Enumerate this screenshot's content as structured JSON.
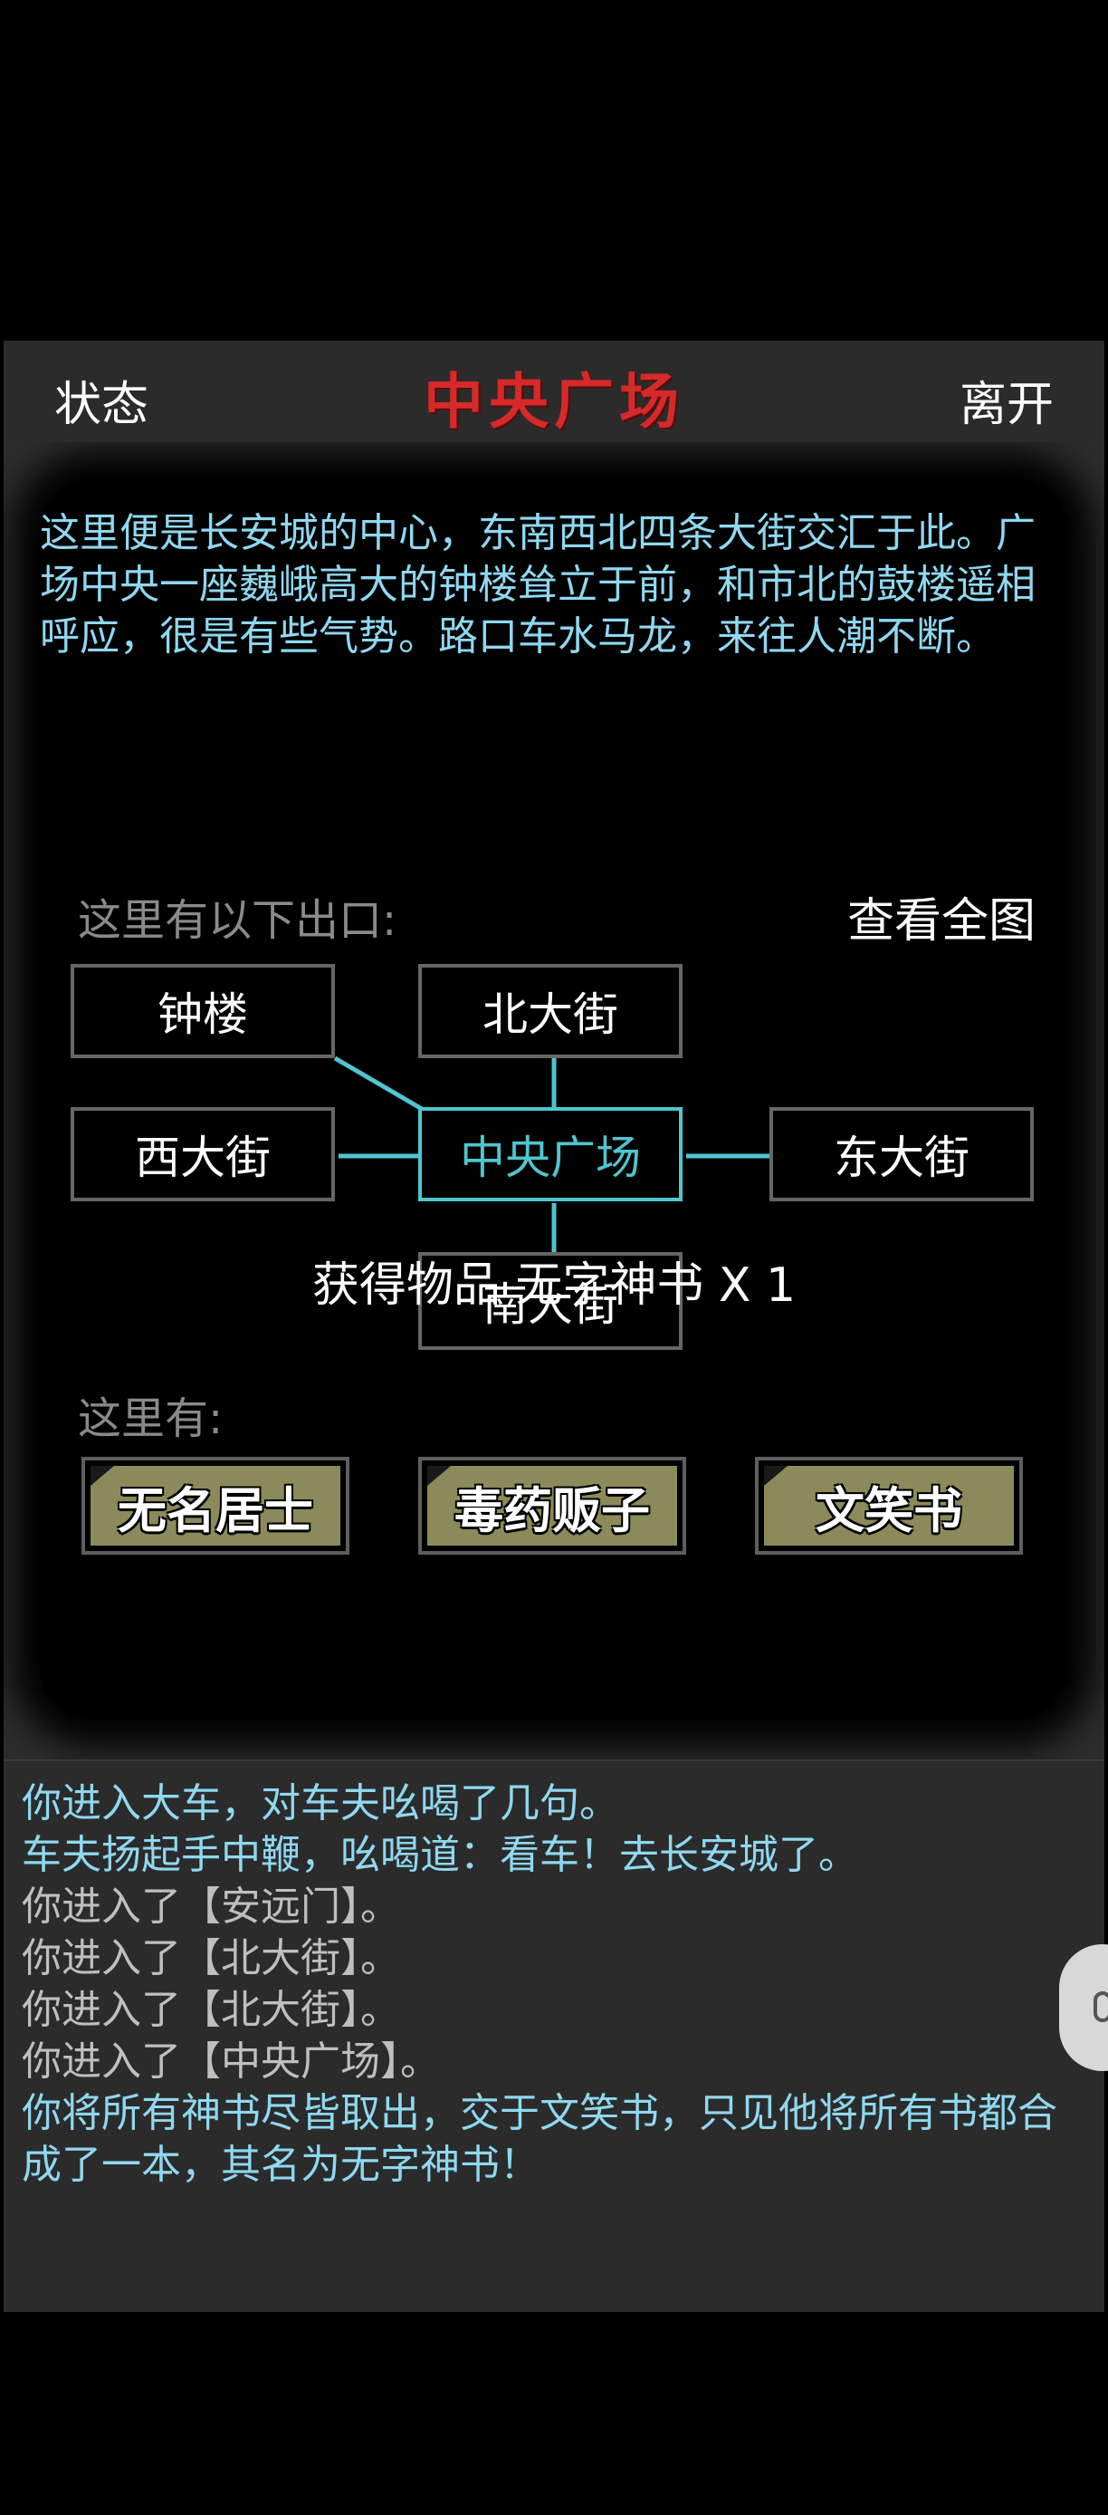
{
  "header": {
    "status_label": "状态",
    "title": "中央广场",
    "leave_label": "离开"
  },
  "scene": {
    "description": "这里便是长安城的中心，东南西北四条大街交汇于此。广场中央一座巍峨高大的钟楼耸立于前，和市北的鼓楼遥相呼应，很是有些气势。路口车水马龙，来往人潮不断。",
    "exits_label": "这里有以下出口:",
    "view_map_label": "查看全图",
    "exits": {
      "northwest": "钟楼",
      "north": "北大街",
      "west": "西大街",
      "center": "中央广场",
      "east": "东大街",
      "south": "南大街"
    },
    "toast": "获得物品 无字神书 X 1",
    "here_label": "这里有:",
    "npcs": [
      "无名居士",
      "毒药贩子",
      "文笑书"
    ]
  },
  "log": [
    {
      "text": "你进入大车，对车夫吆喝了几句。",
      "color": "cyan"
    },
    {
      "text": "车夫扬起手中鞭，吆喝道：看车！去长安城了。",
      "color": "cyan"
    },
    {
      "text": "你进入了【安远门】。",
      "color": "gray"
    },
    {
      "text": "你进入了【北大街】。",
      "color": "gray"
    },
    {
      "text": "你进入了【北大街】。",
      "color": "gray"
    },
    {
      "text": "你进入了【中央广场】。",
      "color": "gray"
    },
    {
      "text": "你将所有神书尽皆取出，交于文笑书，只见他将所有书都合成了一本，其名为无字神书！",
      "color": "cyan"
    }
  ],
  "colors": {
    "title": "#d62a2a",
    "accent": "#4fc6cf",
    "description": "#8fd8f0",
    "npc_button": "#8c8a5a"
  }
}
